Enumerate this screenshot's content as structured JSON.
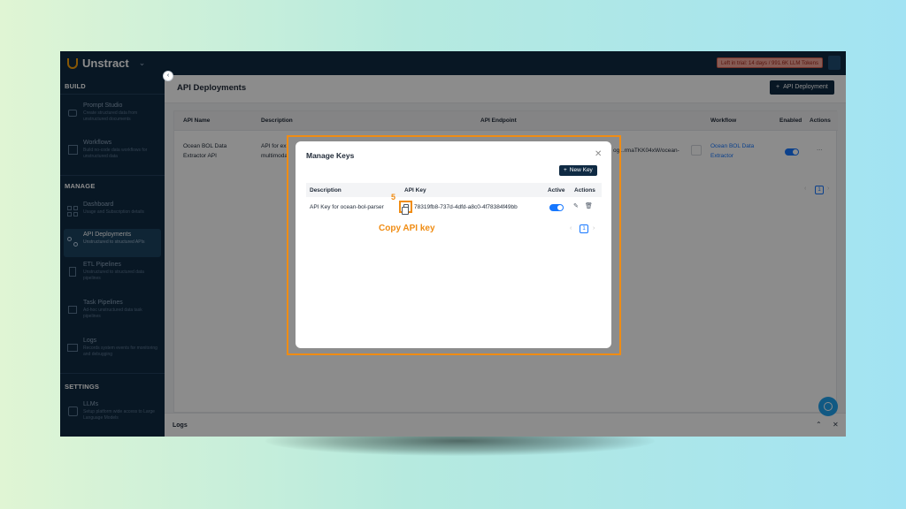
{
  "app": {
    "brand": "Unstract",
    "trial_badge": "Left in trial: 14 days / 991.6K LLM Tokens"
  },
  "sidebar": {
    "sections": [
      {
        "label": "BUILD"
      },
      {
        "label": "MANAGE"
      },
      {
        "label": "SETTINGS"
      }
    ],
    "items": [
      {
        "title": "Prompt Studio",
        "desc": "Create structured data from unstructured documents",
        "icon": "prompt-studio-icon",
        "active": false
      },
      {
        "title": "Workflows",
        "desc": "Build no-code data workflows for unstructured data",
        "icon": "workflows-icon",
        "active": false
      },
      {
        "title": "Dashboard",
        "desc": "Usage and Subscription details",
        "icon": "dashboard-icon",
        "active": false
      },
      {
        "title": "API Deployments",
        "desc": "Unstructured to structured APIs",
        "icon": "api-deployments-icon",
        "active": true
      },
      {
        "title": "ETL Pipelines",
        "desc": "Unstructured to structured data pipelines",
        "icon": "etl-pipelines-icon",
        "active": false
      },
      {
        "title": "Task Pipelines",
        "desc": "Ad-hoc unstructured data task pipelines",
        "icon": "task-pipelines-icon",
        "active": false
      },
      {
        "title": "Logs",
        "desc": "Records system events for monitoring and debugging",
        "icon": "logs-icon",
        "active": false
      },
      {
        "title": "LLMs",
        "desc": "Setup platform wide access to Large Language Models",
        "icon": "llms-icon",
        "active": false
      }
    ]
  },
  "page": {
    "title": "API Deployments",
    "add_button": "API Deployment"
  },
  "table": {
    "columns": [
      "API Name",
      "Description",
      "API Endpoint",
      "Workflow",
      "Enabled",
      "Actions"
    ],
    "rows": [
      {
        "name_line1": "Ocean BOL Data",
        "name_line2": "Extractor API",
        "desc_line1": "API for ex",
        "desc_line2": "multimodal",
        "endpoint": "og...rmaTKK04xW/ocean-",
        "workflow_line1": "Ocean BOL Data",
        "workflow_line2": "Extractor",
        "enabled": true,
        "actions": "···"
      }
    ],
    "page": "1"
  },
  "logs": {
    "label": "Logs"
  },
  "modal": {
    "title": "Manage Keys",
    "new_key_button": "New Key",
    "columns": [
      "Description",
      "API Key",
      "Active",
      "Actions"
    ],
    "rows": [
      {
        "description": "API Key for ocean-bol-parser",
        "api_key": "78319fb8-737d-4dfd-a8c0-4f78384f49bb",
        "active": true
      }
    ],
    "page": "1"
  },
  "annotation": {
    "step_number": "5",
    "label": "Copy API key",
    "color": "#f08c13"
  }
}
